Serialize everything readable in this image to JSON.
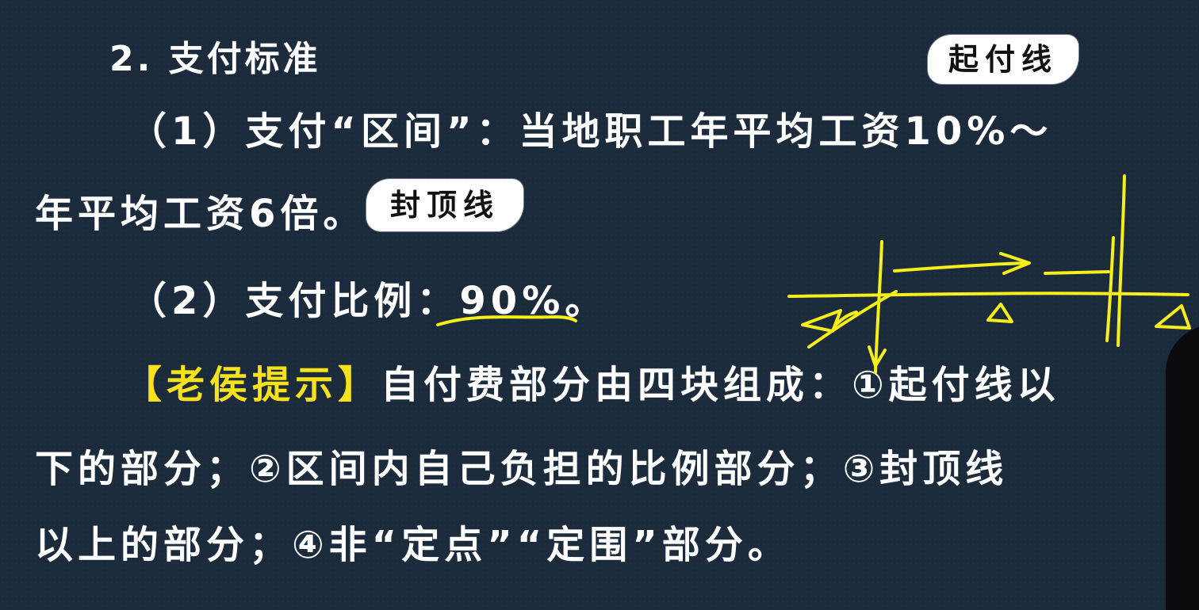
{
  "section": {
    "title": "2. 支付标准"
  },
  "labels": {
    "start_line": "起付线",
    "cap_line": "封顶线"
  },
  "items": [
    {
      "line1": "（1）支付“区间”：当地职工年平均工资10%～",
      "line2": "年平均工资6倍。"
    },
    {
      "prefix": "（2）支付比例：",
      "value": "90%。"
    }
  ],
  "tip": {
    "label": "【老侯提示】",
    "line1": "自付费部分由四块组成：①起付线以",
    "line2": "下的部分；②区间内自己负担的比例部分；③封顶线",
    "line3": "以上的部分；④非“定点”“定围”部分。"
  },
  "colors": {
    "background": "#1b2b3c",
    "text": "#ffffff",
    "highlight": "#f5e11c",
    "annotation": "#f5ee1a"
  }
}
